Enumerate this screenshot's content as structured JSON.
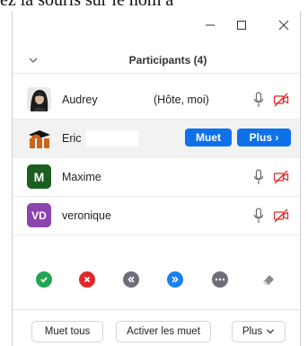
{
  "caption": {
    "text": "ez la souris sur le nom a"
  },
  "panel": {
    "title": "Participants (4)"
  },
  "participants": [
    {
      "name": "Audrey",
      "tag": "(Hôte, moi)"
    },
    {
      "name": "Eric",
      "mute_label": "Muet",
      "more_label": "Plus ›"
    },
    {
      "name": "Maxime",
      "avatar_letter": "M",
      "avatar_color": "#1b5e20"
    },
    {
      "name": "veronique",
      "avatar_letter": "VD",
      "avatar_color": "#8e44ad"
    }
  ],
  "reactions": [
    "yes-icon",
    "no-icon",
    "slower-icon",
    "faster-icon",
    "more-icon",
    "clear-icon"
  ],
  "footer": {
    "mute_all": "Muet tous",
    "unmute": "Activer les muet",
    "more": "Plus"
  },
  "colors": {
    "accent": "#0e71eb",
    "red": "#e02828",
    "green": "#23a455"
  }
}
